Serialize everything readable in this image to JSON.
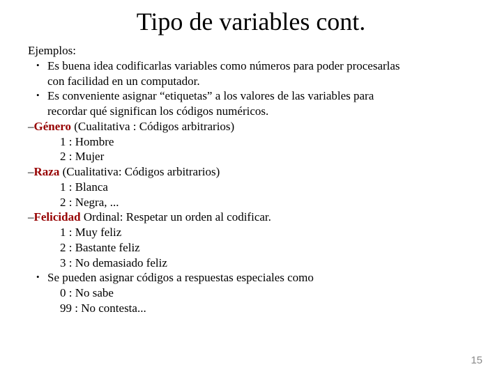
{
  "title": "Tipo de variables cont.",
  "subhead": "Ejemplos:",
  "bullets": {
    "b1a": "Es buena idea codificarlas variables como números para poder procesarlas",
    "b1b": "con facilidad en un computador.",
    "b2a": "Es conveniente asignar “etiquetas” a los valores de las variables para",
    "b2b": "recordar qué significan los códigos numéricos.",
    "b3": "Se pueden asignar códigos a respuestas especiales como"
  },
  "vars": {
    "genero": {
      "dash": "–",
      "name": "Género",
      "desc": " (Cualitativa : Códigos arbitrarios)",
      "c1": "1 : Hombre",
      "c2": "2 : Mujer"
    },
    "raza": {
      "dash": "–",
      "name": "Raza",
      "desc": " (Cualitativa: Códigos arbitrarios)",
      "c1": "1 : Blanca",
      "c2": "2 : Negra, ..."
    },
    "felicidad": {
      "dash": "–",
      "name": "Felicidad",
      "desc": " Ordinal: Respetar un orden al codificar.",
      "c1": "1 : Muy feliz",
      "c2": "2 : Bastante feliz",
      "c3": "3 : No demasiado feliz"
    }
  },
  "special": {
    "c1": "0 : No sabe",
    "c2": "99 : No contesta..."
  },
  "page_number": "15"
}
